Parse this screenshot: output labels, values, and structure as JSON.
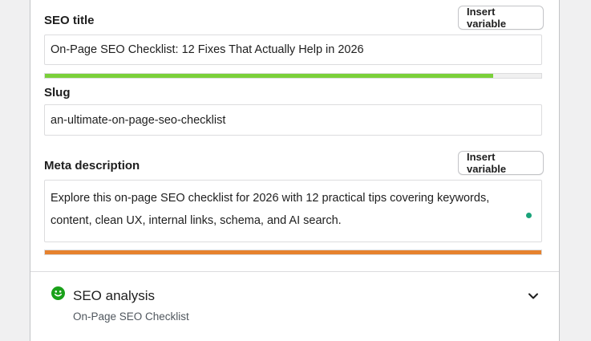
{
  "seo_title": {
    "label": "SEO title",
    "insert_variable_label": "Insert variable",
    "value": "On-Page SEO Checklist: 12 Fixes That Actually Help in 2026",
    "progress": 0.903,
    "progress_color": "#7ad03a"
  },
  "slug": {
    "label": "Slug",
    "value": "an-ultimate-on-page-seo-checklist"
  },
  "meta_description": {
    "label": "Meta description",
    "insert_variable_label": "Insert variable",
    "value": "Explore this on-page SEO checklist for 2026 with 12 practical tips covering keywords, content, clean UX, internal links, schema, and AI search.",
    "progress": 1.0,
    "progress_color": "#e6822e",
    "indicator_color": "#1aa37a"
  },
  "seo_analysis": {
    "title": "SEO analysis",
    "subtitle": "On-Page SEO Checklist",
    "status_icon": "smiley-icon",
    "status_color": "#1aa11a",
    "expand_icon": "chevron-down-icon"
  }
}
